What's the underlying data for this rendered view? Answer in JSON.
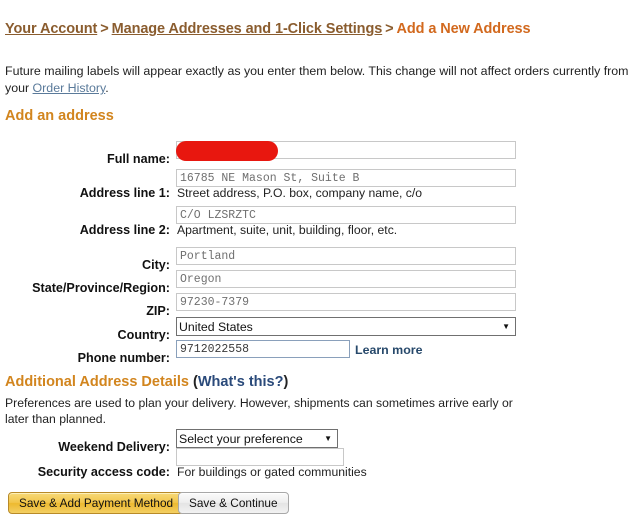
{
  "breadcrumb": {
    "items": [
      {
        "label": "Your Account",
        "type": "link"
      },
      {
        "label": "Manage Addresses and 1-Click Settings",
        "type": "link"
      },
      {
        "label": "Add a New Address",
        "type": "current"
      }
    ],
    "separator": ">"
  },
  "intro": {
    "text_before": "Future mailing labels will appear exactly as you enter them below. This change will not affect orders currently from your ",
    "link_label": "Order History",
    "text_after": "."
  },
  "add_address": {
    "heading": "Add an address",
    "fields": {
      "full_name": {
        "label": "Full name:",
        "value": "",
        "redacted": true
      },
      "address_line_1": {
        "label": "Address line 1:",
        "value": "16785 NE Mason St, Suite B",
        "helper": "Street address, P.O. box, company name, c/o"
      },
      "address_line_2": {
        "label": "Address line 2:",
        "value": "C/O LZSRZTC",
        "helper": "Apartment, suite, unit, building, floor, etc."
      },
      "city": {
        "label": "City:",
        "value": "Portland"
      },
      "state": {
        "label": "State/Province/Region:",
        "value": "Oregon"
      },
      "zip": {
        "label": "ZIP:",
        "value": "97230-7379"
      },
      "country": {
        "label": "Country:",
        "value": "United States",
        "options": [
          "United States"
        ],
        "arrow": "▼"
      },
      "phone": {
        "label": "Phone number:",
        "value": "9712022558",
        "focused": true,
        "learn_more": "Learn more"
      }
    }
  },
  "additional_details": {
    "heading": "Additional Address Details",
    "whats_this": "What's this?",
    "open_paren": "(",
    "close_paren": ")",
    "description": "Preferences are used to plan your delivery. However, shipments can sometimes arrive early or later than planned.",
    "fields": {
      "weekend_delivery": {
        "label": "Weekend Delivery:",
        "value": "Select your preference",
        "options": [
          "Select your preference"
        ],
        "arrow": "▼"
      },
      "security_code": {
        "label": "Security access code:",
        "value": "",
        "helper": "For buildings or gated communities"
      }
    }
  },
  "buttons": {
    "save_payment": "Save & Add Payment Method",
    "save_continue": "Save & Continue"
  },
  "colors": {
    "breadcrumb_link": "#8a5c2e",
    "breadcrumb_current": "#d2691e",
    "section_heading": "#d2851e",
    "link_blue": "#5a7a9a",
    "redaction": "#e8170f",
    "primary_button": "#f2c54a"
  }
}
